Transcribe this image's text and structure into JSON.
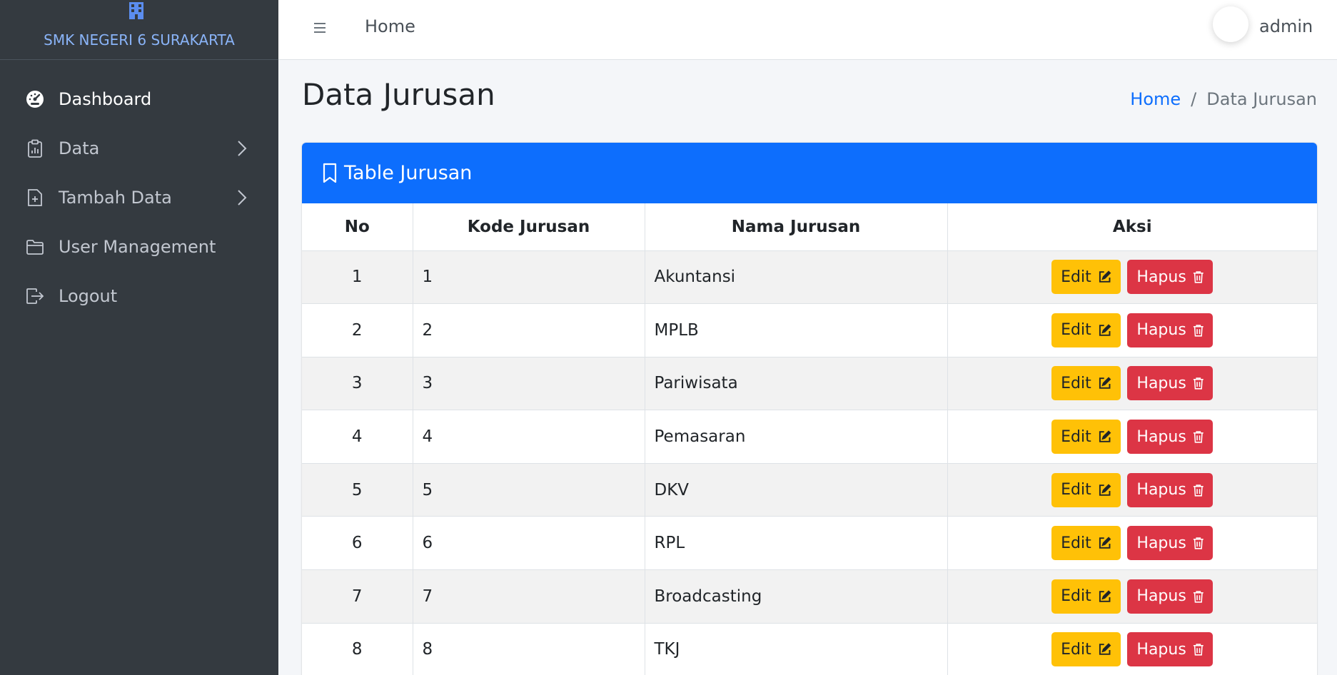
{
  "sidebar": {
    "brand": "SMK NEGERI 6 SURAKARTA",
    "items": [
      {
        "label": "Dashboard",
        "icon": "speedometer-icon",
        "active": true
      },
      {
        "label": "Data",
        "icon": "clipboard-data-icon",
        "has_submenu": true
      },
      {
        "label": "Tambah Data",
        "icon": "file-plus-icon",
        "has_submenu": true
      },
      {
        "label": "User Management",
        "icon": "folder-icon"
      },
      {
        "label": "Logout",
        "icon": "box-arrow-right-icon"
      }
    ]
  },
  "topbar": {
    "home_link": "Home",
    "username": "admin"
  },
  "page": {
    "title": "Data Jurusan",
    "breadcrumb": {
      "home": "Home",
      "separator": "/",
      "current": "Data Jurusan"
    }
  },
  "card": {
    "title": "Table Jurusan",
    "columns": [
      "No",
      "Kode Jurusan",
      "Nama Jurusan",
      "Aksi"
    ],
    "rows": [
      {
        "no": "1",
        "kode": "1",
        "nama": "Akuntansi"
      },
      {
        "no": "2",
        "kode": "2",
        "nama": "MPLB"
      },
      {
        "no": "3",
        "kode": "3",
        "nama": "Pariwisata"
      },
      {
        "no": "4",
        "kode": "4",
        "nama": "Pemasaran"
      },
      {
        "no": "5",
        "kode": "5",
        "nama": "DKV"
      },
      {
        "no": "6",
        "kode": "6",
        "nama": "RPL"
      },
      {
        "no": "7",
        "kode": "7",
        "nama": "Broadcasting"
      },
      {
        "no": "8",
        "kode": "8",
        "nama": "TKJ"
      }
    ],
    "edit_label": "Edit",
    "delete_label": "Hapus"
  },
  "colors": {
    "sidebar_bg": "#343a40",
    "primary": "#0d6efd",
    "warning": "#ffc107",
    "danger": "#dc3545"
  }
}
